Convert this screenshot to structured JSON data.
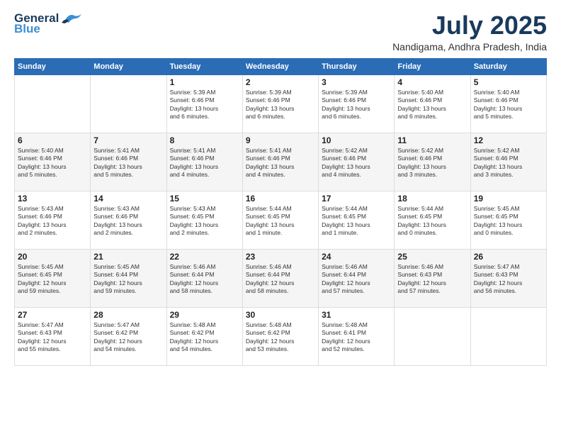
{
  "header": {
    "logo_line1": "General",
    "logo_line2": "Blue",
    "month": "July 2025",
    "location": "Nandigama, Andhra Pradesh, India"
  },
  "weekdays": [
    "Sunday",
    "Monday",
    "Tuesday",
    "Wednesday",
    "Thursday",
    "Friday",
    "Saturday"
  ],
  "weeks": [
    [
      {
        "day": "",
        "detail": ""
      },
      {
        "day": "",
        "detail": ""
      },
      {
        "day": "1",
        "detail": "Sunrise: 5:39 AM\nSunset: 6:46 PM\nDaylight: 13 hours\nand 6 minutes."
      },
      {
        "day": "2",
        "detail": "Sunrise: 5:39 AM\nSunset: 6:46 PM\nDaylight: 13 hours\nand 6 minutes."
      },
      {
        "day": "3",
        "detail": "Sunrise: 5:39 AM\nSunset: 6:46 PM\nDaylight: 13 hours\nand 6 minutes."
      },
      {
        "day": "4",
        "detail": "Sunrise: 5:40 AM\nSunset: 6:46 PM\nDaylight: 13 hours\nand 6 minutes."
      },
      {
        "day": "5",
        "detail": "Sunrise: 5:40 AM\nSunset: 6:46 PM\nDaylight: 13 hours\nand 5 minutes."
      }
    ],
    [
      {
        "day": "6",
        "detail": "Sunrise: 5:40 AM\nSunset: 6:46 PM\nDaylight: 13 hours\nand 5 minutes."
      },
      {
        "day": "7",
        "detail": "Sunrise: 5:41 AM\nSunset: 6:46 PM\nDaylight: 13 hours\nand 5 minutes."
      },
      {
        "day": "8",
        "detail": "Sunrise: 5:41 AM\nSunset: 6:46 PM\nDaylight: 13 hours\nand 4 minutes."
      },
      {
        "day": "9",
        "detail": "Sunrise: 5:41 AM\nSunset: 6:46 PM\nDaylight: 13 hours\nand 4 minutes."
      },
      {
        "day": "10",
        "detail": "Sunrise: 5:42 AM\nSunset: 6:46 PM\nDaylight: 13 hours\nand 4 minutes."
      },
      {
        "day": "11",
        "detail": "Sunrise: 5:42 AM\nSunset: 6:46 PM\nDaylight: 13 hours\nand 3 minutes."
      },
      {
        "day": "12",
        "detail": "Sunrise: 5:42 AM\nSunset: 6:46 PM\nDaylight: 13 hours\nand 3 minutes."
      }
    ],
    [
      {
        "day": "13",
        "detail": "Sunrise: 5:43 AM\nSunset: 6:46 PM\nDaylight: 13 hours\nand 2 minutes."
      },
      {
        "day": "14",
        "detail": "Sunrise: 5:43 AM\nSunset: 6:46 PM\nDaylight: 13 hours\nand 2 minutes."
      },
      {
        "day": "15",
        "detail": "Sunrise: 5:43 AM\nSunset: 6:45 PM\nDaylight: 13 hours\nand 2 minutes."
      },
      {
        "day": "16",
        "detail": "Sunrise: 5:44 AM\nSunset: 6:45 PM\nDaylight: 13 hours\nand 1 minute."
      },
      {
        "day": "17",
        "detail": "Sunrise: 5:44 AM\nSunset: 6:45 PM\nDaylight: 13 hours\nand 1 minute."
      },
      {
        "day": "18",
        "detail": "Sunrise: 5:44 AM\nSunset: 6:45 PM\nDaylight: 13 hours\nand 0 minutes."
      },
      {
        "day": "19",
        "detail": "Sunrise: 5:45 AM\nSunset: 6:45 PM\nDaylight: 13 hours\nand 0 minutes."
      }
    ],
    [
      {
        "day": "20",
        "detail": "Sunrise: 5:45 AM\nSunset: 6:45 PM\nDaylight: 12 hours\nand 59 minutes."
      },
      {
        "day": "21",
        "detail": "Sunrise: 5:45 AM\nSunset: 6:44 PM\nDaylight: 12 hours\nand 59 minutes."
      },
      {
        "day": "22",
        "detail": "Sunrise: 5:46 AM\nSunset: 6:44 PM\nDaylight: 12 hours\nand 58 minutes."
      },
      {
        "day": "23",
        "detail": "Sunrise: 5:46 AM\nSunset: 6:44 PM\nDaylight: 12 hours\nand 58 minutes."
      },
      {
        "day": "24",
        "detail": "Sunrise: 5:46 AM\nSunset: 6:44 PM\nDaylight: 12 hours\nand 57 minutes."
      },
      {
        "day": "25",
        "detail": "Sunrise: 5:46 AM\nSunset: 6:43 PM\nDaylight: 12 hours\nand 57 minutes."
      },
      {
        "day": "26",
        "detail": "Sunrise: 5:47 AM\nSunset: 6:43 PM\nDaylight: 12 hours\nand 56 minutes."
      }
    ],
    [
      {
        "day": "27",
        "detail": "Sunrise: 5:47 AM\nSunset: 6:43 PM\nDaylight: 12 hours\nand 55 minutes."
      },
      {
        "day": "28",
        "detail": "Sunrise: 5:47 AM\nSunset: 6:42 PM\nDaylight: 12 hours\nand 54 minutes."
      },
      {
        "day": "29",
        "detail": "Sunrise: 5:48 AM\nSunset: 6:42 PM\nDaylight: 12 hours\nand 54 minutes."
      },
      {
        "day": "30",
        "detail": "Sunrise: 5:48 AM\nSunset: 6:42 PM\nDaylight: 12 hours\nand 53 minutes."
      },
      {
        "day": "31",
        "detail": "Sunrise: 5:48 AM\nSunset: 6:41 PM\nDaylight: 12 hours\nand 52 minutes."
      },
      {
        "day": "",
        "detail": ""
      },
      {
        "day": "",
        "detail": ""
      }
    ]
  ]
}
